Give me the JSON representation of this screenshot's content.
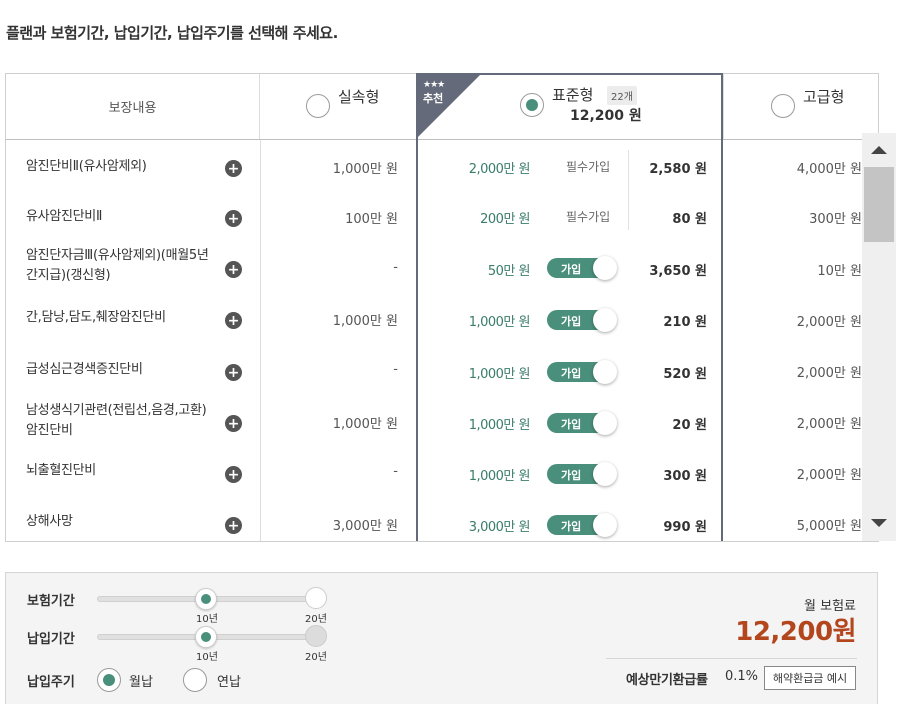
{
  "instruction": "플랜과 보험기간, 납입기간, 납입주기를 선택해 주세요.",
  "header": {
    "coverage_label": "보장내용",
    "plans": [
      {
        "name": "실속형",
        "selected": false
      },
      {
        "name": "표준형",
        "selected": true,
        "ribbon_stars": "★★★",
        "ribbon_text": "추천",
        "badge": "22개",
        "price": "12,200 원"
      },
      {
        "name": "고급형",
        "selected": false
      }
    ]
  },
  "join_label": "가입",
  "rows": [
    {
      "name": "암진단비Ⅱ(유사암제외)",
      "silsok": "1,000만 원",
      "std": "2,000만 원",
      "status": "필수가입",
      "std_price": "2,580 원",
      "premium": "4,000만 원"
    },
    {
      "name": "유사암진단비Ⅱ",
      "silsok": "100만 원",
      "std": "200만 원",
      "status": "필수가입",
      "std_price": "80 원",
      "premium": "300만 원"
    },
    {
      "name": "암진단자금Ⅲ(유사암제외)(매월5년간지급)(갱신형)",
      "silsok": "-",
      "std": "50만 원",
      "status": "toggle",
      "std_price": "3,650 원",
      "premium": "10만 원"
    },
    {
      "name": "간,담낭,담도,췌장암진단비",
      "silsok": "1,000만 원",
      "std": "1,000만 원",
      "status": "toggle",
      "std_price": "210 원",
      "premium": "2,000만 원"
    },
    {
      "name": "급성심근경색증진단비",
      "silsok": "-",
      "std": "1,000만 원",
      "status": "toggle",
      "std_price": "520 원",
      "premium": "2,000만 원"
    },
    {
      "name": "남성생식기관련(전립선,음경,고환)암진단비",
      "silsok": "1,000만 원",
      "std": "1,000만 원",
      "status": "toggle",
      "std_price": "20 원",
      "premium": "2,000만 원"
    },
    {
      "name": "뇌출혈진단비",
      "silsok": "-",
      "std": "1,000만 원",
      "status": "toggle",
      "std_price": "300 원",
      "premium": "2,000만 원"
    },
    {
      "name": "상해사망",
      "silsok": "3,000만 원",
      "std": "3,000만 원",
      "status": "toggle",
      "std_price": "990 원",
      "premium": "5,000만 원"
    }
  ],
  "bottom": {
    "insurance_period": {
      "label": "보험기간",
      "ticks": [
        "10년",
        "20년"
      ],
      "selected": "10년"
    },
    "payment_period": {
      "label": "납입기간",
      "ticks": [
        "10년",
        "20년"
      ],
      "selected": "10년"
    },
    "payment_cycle": {
      "label": "납입주기",
      "options": [
        "월납",
        "연납"
      ],
      "selected": "월납"
    },
    "monthly_label": "월 보험료",
    "monthly_amount": "12,200원",
    "refund_label": "예상만기환급률",
    "refund_rate": "0.1%",
    "refund_button": "해약환급금 예시"
  },
  "colors": {
    "accent": "#4a8f7b",
    "price": "#b4461e",
    "frame": "#656a7a"
  },
  "icons": {
    "plus": "plus-circle-icon",
    "scroll_up": "triangle-up-icon",
    "scroll_down": "triangle-down-icon"
  }
}
